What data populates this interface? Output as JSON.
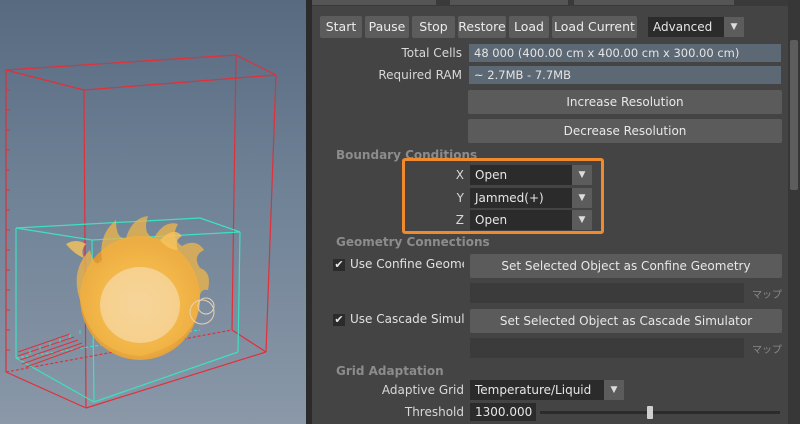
{
  "toolbar": {
    "start": "Start",
    "pause": "Pause",
    "stop": "Stop",
    "restore": "Restore",
    "load": "Load",
    "load_current": "Load Current",
    "mode": "Advanced"
  },
  "info": {
    "total_cells_label": "Total Cells",
    "total_cells_value": "48 000 (400.00 cm x 400.00 cm x 300.00 cm)",
    "required_ram_label": "Required RAM",
    "required_ram_value": "~ 2.7MB - 7.7MB",
    "increase_resolution": "Increase Resolution",
    "decrease_resolution": "Decrease Resolution"
  },
  "boundary": {
    "title": "Boundary Conditions",
    "x_label": "X",
    "x_value": "Open",
    "y_label": "Y",
    "y_value": "Jammed(+)",
    "z_label": "Z",
    "z_value": "Open"
  },
  "geometry": {
    "title": "Geometry Connections",
    "confine_checkbox": "Use Confine Geome",
    "confine_checked": true,
    "set_confine": "Set Selected Object as Confine Geometry",
    "map1": "マップ",
    "cascade_checkbox": "Use Cascade Simula",
    "cascade_checked": true,
    "set_cascade": "Set Selected Object as Cascade Simulator",
    "map2": "マップ"
  },
  "grid": {
    "title": "Grid Adaptation",
    "adaptive_label": "Adaptive Grid",
    "adaptive_value": "Temperature/Liquid",
    "threshold_label": "Threshold",
    "threshold_value": "1300.000",
    "threshold_fraction": 0.46
  },
  "colors": {
    "highlight": "#f08a2c",
    "outer_box": "#e0303a",
    "inner_box": "#3ee0c0"
  },
  "check_mark": "✔",
  "arrow_glyph": "▼"
}
